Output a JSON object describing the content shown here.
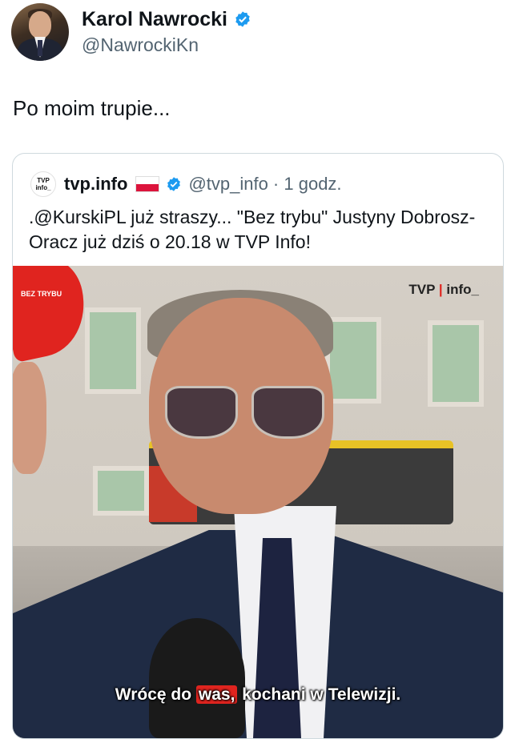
{
  "author": {
    "name": "Karol Nawrocki",
    "handle": "@NawrockiKn"
  },
  "tweet_text": "Po moim trupie...",
  "quote": {
    "logo_line1": "TVP",
    "logo_line2": "info_",
    "name": "tvp.info",
    "handle_time": "@tvp_info · 1 godz.",
    "text": ".@KurskiPL już straszy... \"Bez trybu\" Justyny Dobrosz-Oracz już dziś o 20.18 w TVP Info!",
    "media": {
      "badge": "BEZ TRYBU",
      "watermark_a": "TVP",
      "watermark_b": "info_",
      "subtitle_a": "Wrócę do ",
      "subtitle_hl": "was,",
      "subtitle_b": " kochani w Telewizji."
    }
  },
  "colors": {
    "verified": "#1d9bf0",
    "tvp_red": "#e0241f"
  },
  "icons": [
    "verified-badge-icon",
    "poland-flag-icon"
  ]
}
